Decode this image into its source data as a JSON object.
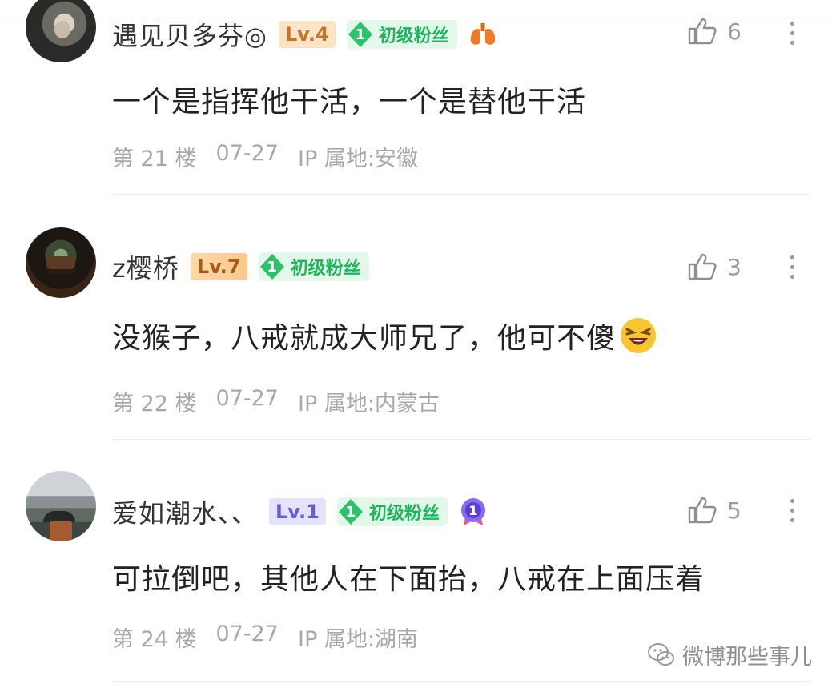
{
  "comments": [
    {
      "username": "遇见贝多芬◎",
      "level": "Lv.4",
      "fan_badge_num": "1",
      "fan_badge_label": "初级粉丝",
      "extra_badge": "lungs-icon",
      "likes": "6",
      "text": "一个是指挥他干活，一个是替他干活",
      "floor": "第 21 楼",
      "date": "07-27",
      "ip": "IP 属地:安徽"
    },
    {
      "username": "z樱桥",
      "level": "Lv.7",
      "fan_badge_num": "1",
      "fan_badge_label": "初级粉丝",
      "likes": "3",
      "text": "没猴子，八戒就成大师兄了，他可不傻",
      "text_emoji": "laughing-emoji",
      "floor": "第 22 楼",
      "date": "07-27",
      "ip": "IP 属地:内蒙古"
    },
    {
      "username": "爱如潮水、、",
      "level": "Lv.1",
      "fan_badge_num": "1",
      "fan_badge_label": "初级粉丝",
      "extra_badge": "medal-icon",
      "likes": "5",
      "text": "可拉倒吧，其他人在下面抬，八戒在上面压着",
      "floor": "第 24 楼",
      "date": "07-27",
      "ip": "IP 属地:湖南"
    }
  ],
  "watermark": {
    "text": "微博那些事儿",
    "icon": "wechat-icon"
  },
  "colors": {
    "fan_green": "#22b35c",
    "fan_bg": "#e2f8ea",
    "meta_gray": "#a8a8a8",
    "text_dark": "#222222"
  }
}
